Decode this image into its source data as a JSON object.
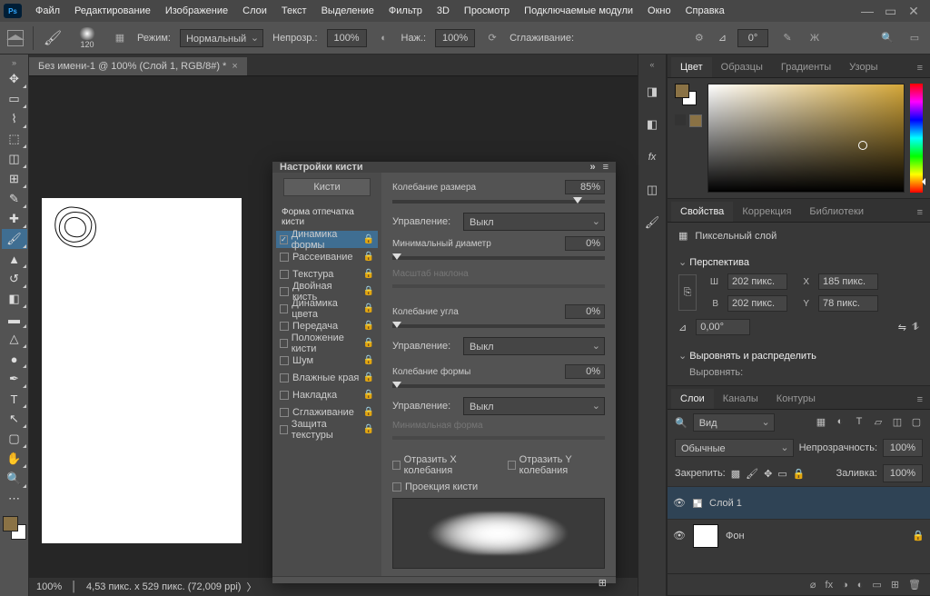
{
  "menu": [
    "Файл",
    "Редактирование",
    "Изображение",
    "Слои",
    "Текст",
    "Выделение",
    "Фильтр",
    "3D",
    "Просмотр",
    "Подключаемые модули",
    "Окно",
    "Справка"
  ],
  "opt": {
    "brush_size": "120",
    "mode_l": "Режим:",
    "mode": "Нормальный",
    "opac_l": "Непрозр.:",
    "opac": "100%",
    "flow_l": "Наж.:",
    "flow": "100%",
    "smooth_l": "Сглаживание:",
    "angle_l": "⊿",
    "angle": "0°"
  },
  "doc": {
    "tab": "Без имени-1 @ 100% (Слой 1, RGB/8#) *",
    "status_zoom": "100%",
    "status_dim": "4,53 пикс. x 529 пикс. (72,009 ppi)"
  },
  "color_tabs": [
    "Цвет",
    "Образцы",
    "Градиенты",
    "Узоры"
  ],
  "props": {
    "tabs": [
      "Свойства",
      "Коррекция",
      "Библиотеки"
    ],
    "kind": "Пиксельный слой",
    "persp": "Перспектива",
    "w": "202 пикс.",
    "x": "185 пикс.",
    "h": "202 пикс.",
    "y": "78 пикс.",
    "ang": "0,00°",
    "align_h": "Выровнять и распределить",
    "align_l": "Выровнять:"
  },
  "layers": {
    "tabs": [
      "Слои",
      "Каналы",
      "Контуры"
    ],
    "search_l": "Вид",
    "blend": "Обычные",
    "opac_l": "Непрозрачность:",
    "opac": "100%",
    "lock_l": "Закрепить:",
    "fill_l": "Заливка:",
    "fill": "100%",
    "items": [
      {
        "name": "Слой 1"
      },
      {
        "name": "Фон"
      }
    ]
  },
  "brush": {
    "title": "Настройки кисти",
    "btn": "Кисти",
    "shape": "Форма отпечатка кисти",
    "rows": [
      {
        "n": "Динамика формы",
        "c": true,
        "a": true
      },
      {
        "n": "Рассеивание",
        "c": false
      },
      {
        "n": "Текстура",
        "c": false
      },
      {
        "n": "Двойная кисть",
        "c": false
      },
      {
        "n": "Динамика цвета",
        "c": false
      },
      {
        "n": "Передача",
        "c": false
      },
      {
        "n": "Положение кисти",
        "c": false
      },
      {
        "n": "Шум",
        "c": false
      },
      {
        "n": "Влажные края",
        "c": false
      },
      {
        "n": "Накладка",
        "c": false
      },
      {
        "n": "Сглаживание",
        "c": false
      },
      {
        "n": "Защита текстуры",
        "c": false
      }
    ],
    "r": {
      "jit_size": "Колебание размера",
      "jit_size_v": "85%",
      "ctrl": "Управление:",
      "off": "Выкл",
      "min_d": "Минимальный диаметр",
      "min_d_v": "0%",
      "tilt": "Масштаб наклона",
      "jit_ang": "Колебание угла",
      "jit_ang_v": "0%",
      "jit_rnd": "Колебание формы",
      "jit_rnd_v": "0%",
      "min_rnd": "Минимальная форма",
      "flipx": "Отразить X колебания",
      "flipy": "Отразить Y колебания",
      "proj": "Проекция кисти"
    }
  }
}
